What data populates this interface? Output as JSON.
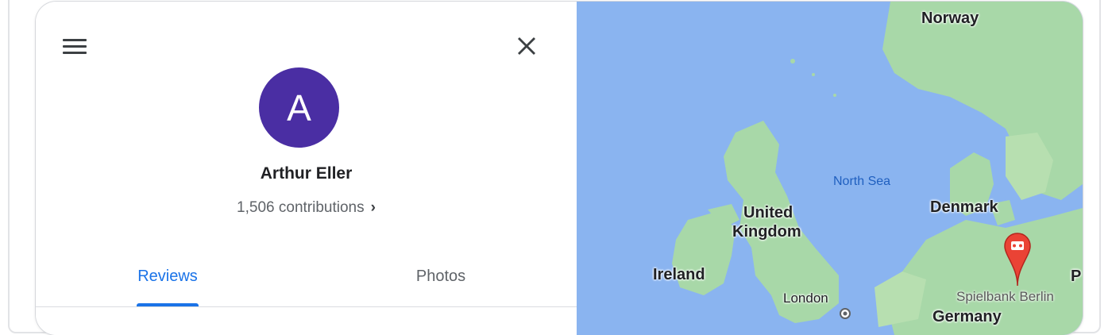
{
  "profile": {
    "avatar_letter": "A",
    "avatar_color": "#4a2ea3",
    "name": "Arthur Eller",
    "contributions": "1,506 contributions",
    "contributions_chevron": "›"
  },
  "header": {
    "menu_icon": "hamburger-menu-icon",
    "close_icon": "close-icon"
  },
  "tabs": [
    {
      "label": "Reviews",
      "active": true
    },
    {
      "label": "Photos",
      "active": false
    }
  ],
  "colors": {
    "accent": "#1a73e8",
    "water": "#8ab4f0",
    "land": "#a8d8a8",
    "marker": "#ea4335"
  },
  "map": {
    "labels": {
      "norway": "Norway",
      "north_sea": "North Sea",
      "denmark": "Denmark",
      "united_kingdom_line1": "United",
      "united_kingdom_line2": "Kingdom",
      "ireland": "Ireland",
      "london": "London",
      "germany": "Germany",
      "poland_partial": "P"
    },
    "place": {
      "name": "Spielbank Berlin",
      "icon": "casino-marker-icon"
    }
  }
}
